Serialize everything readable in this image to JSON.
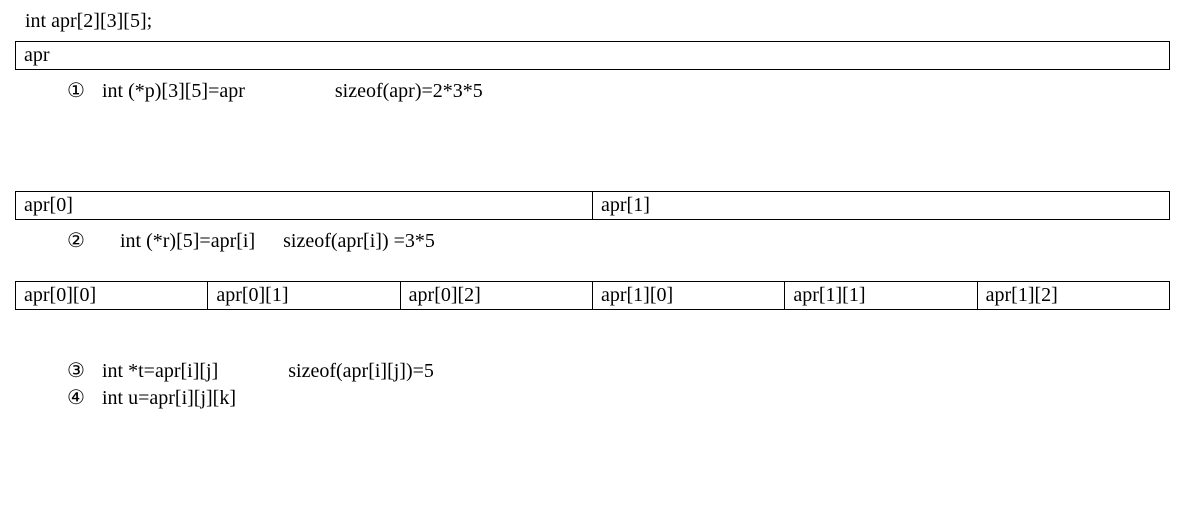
{
  "declaration": "int apr[2][3][5];",
  "level1": {
    "cells": [
      "apr"
    ]
  },
  "note1": {
    "circled": "①",
    "code": "int (*p)[3][5]=apr",
    "sizeof": "sizeof(apr)=2*3*5"
  },
  "level2": {
    "cells": [
      "apr[0]",
      "apr[1]"
    ]
  },
  "note2": {
    "circled": "②",
    "code": "int (*r)[5]=apr[i]",
    "sizeof": "sizeof(apr[i]) =3*5"
  },
  "level3": {
    "cells": [
      "apr[0][0]",
      "apr[0][1]",
      "apr[0][2]",
      "apr[1][0]",
      "apr[1][1]",
      "apr[1][2]"
    ]
  },
  "note3": {
    "circled": "③",
    "code": "int *t=apr[i][j]",
    "sizeof": "sizeof(apr[i][j])=5"
  },
  "note4": {
    "circled": "④",
    "code": "int u=apr[i][j][k]"
  }
}
